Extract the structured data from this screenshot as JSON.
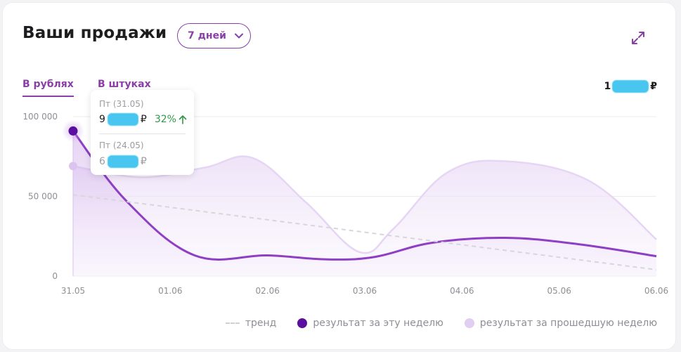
{
  "header": {
    "title": "Ваши продажи",
    "period_label": "7 дней"
  },
  "tabs": {
    "rub": "В рублях",
    "pcs": "В штуках"
  },
  "total": {
    "prefix": "1",
    "currency": "₽"
  },
  "tooltip": {
    "current_date": "Пт (31.05)",
    "current_prefix": "9",
    "current_currency": "₽",
    "change": "32%",
    "previous_date": "Пт (24.05)",
    "previous_prefix": "6",
    "previous_currency": "₽"
  },
  "colors": {
    "accent": "#8a3fa8",
    "current_line": "#8e3fc4",
    "current_dot": "#5b0fa0",
    "previous_line": "#e6d5f3",
    "trend": "#d6d6dc",
    "growth": "#2e9a44",
    "redaction": "#3fc3ef"
  },
  "chart_data": {
    "type": "area",
    "x": [
      "31.05",
      "01.06",
      "02.06",
      "03.06",
      "04.06",
      "05.06",
      "06.06"
    ],
    "yticks": [
      0,
      50000,
      100000
    ],
    "ytick_labels": [
      "0",
      "50 000",
      "100 000"
    ],
    "ylim": [
      0,
      100000
    ],
    "grid": true,
    "legend_position": "bottom-right",
    "series": [
      {
        "name": "результат за эту неделю",
        "x": [
          0,
          0.55,
          1.25,
          2.0,
          2.6,
          3.1,
          3.7,
          4.45,
          5.2,
          6.0
        ],
        "values": [
          91000,
          47000,
          13000,
          13000,
          10500,
          12000,
          21000,
          24000,
          20000,
          12500
        ]
      },
      {
        "name": "результат за прошедшую неделю",
        "x": [
          0,
          0.7,
          1.35,
          1.85,
          2.4,
          2.95,
          3.3,
          3.85,
          4.45,
          5.3,
          6.0
        ],
        "values": [
          69000,
          62000,
          68000,
          74000,
          46000,
          15000,
          30000,
          65000,
          72000,
          60000,
          23000
        ]
      },
      {
        "name": "тренд",
        "x": [
          0,
          6
        ],
        "values": [
          51000,
          4000
        ]
      }
    ]
  }
}
